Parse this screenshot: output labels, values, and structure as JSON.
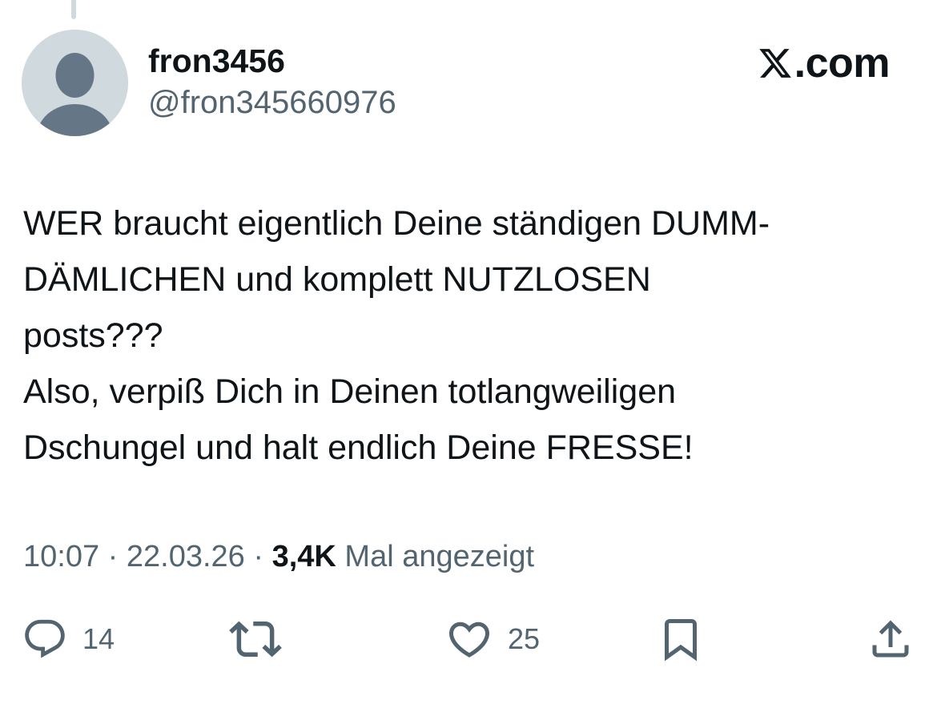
{
  "author": {
    "display_name": "fron3456",
    "handle": "@fron345660976",
    "avatar": "default-avatar-silhouette"
  },
  "brand": {
    "logo": "x-logo",
    "suffix": ".com"
  },
  "tweet": {
    "lines": [
      "WER braucht eigentlich Deine ständigen DUMM-",
      "DÄMLICHEN und komplett NUTZLOSEN",
      "posts???",
      "Also, verpiß Dich in Deinen totlangweiligen",
      "Dschungel und halt endlich Deine FRESSE!"
    ]
  },
  "meta": {
    "time": "10:07",
    "separator": " · ",
    "date": "22.03.26",
    "views_count": "3,4K",
    "views_label": " Mal angezeigt"
  },
  "actions": {
    "reply": {
      "icon": "reply-icon",
      "count": "14"
    },
    "repost": {
      "icon": "repost-icon"
    },
    "like": {
      "icon": "heart-icon",
      "count": "25"
    },
    "bookmark": {
      "icon": "bookmark-icon"
    },
    "share": {
      "icon": "share-icon"
    }
  },
  "colors": {
    "text_primary": "#0f1419",
    "text_secondary": "#536471",
    "avatar_bg": "#cfd9de",
    "avatar_fg": "#657786",
    "background": "#ffffff"
  }
}
